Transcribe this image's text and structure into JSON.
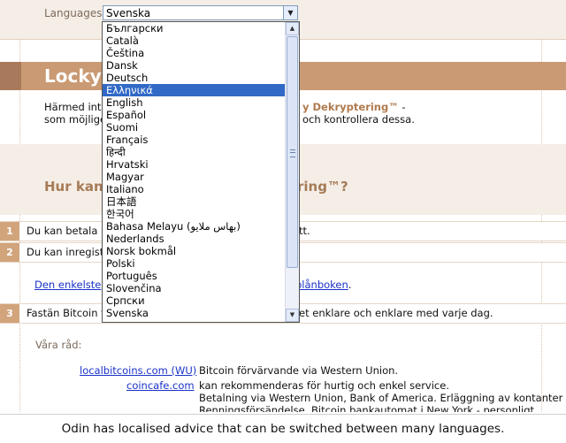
{
  "languages": {
    "label": "Languages:",
    "selected": "Svenska",
    "options": [
      "Български",
      "Català",
      "Čeština",
      "Dansk",
      "Deutsch",
      "Ελληνικά",
      "English",
      "Español",
      "Suomi",
      "Français",
      "हिन्दी",
      "Hrvatski",
      "Magyar",
      "Italiano",
      "日本語",
      "한국어",
      "Bahasa Melayu (بهاس ملايو)",
      "Nederlands",
      "Norsk bokmål",
      "Polski",
      "Português",
      "Slovenčina",
      "Српски",
      "Svenska"
    ],
    "highlighted": "Ελληνικά"
  },
  "header": {
    "title": "Locky"
  },
  "intro": {
    "line1_prefix": "Härmed intr",
    "line1_highlight": "y Dekryptering™",
    "line1_suffix": " -",
    "line2_prefix": "som möjlige",
    "line2_suffix": "och kontrollera dessa."
  },
  "question": {
    "prefix": "Hur kan",
    "suffix": "ring™?"
  },
  "steps": [
    {
      "number": "1",
      "text_prefix": "Du kan betala n",
      "text_suffix": "tt."
    },
    {
      "number": "2",
      "text": "Du kan inregistr"
    },
    {
      "number": "3",
      "text_prefix": "Fastän Bitcoin fö",
      "text_suffix": "et enklare och enklare med varje dag."
    }
  ],
  "sub_link": {
    "prefix": "Den enkelste",
    "suffix": "plånboken"
  },
  "advice": {
    "label": "Våra råd:",
    "rows": [
      {
        "link": "localbitcoins.com (WU)",
        "desc": "Bitcoin förvärvande via Western Union."
      },
      {
        "link": "coincafe.com",
        "desc": "kan rekommenderas för hurtig och enkel service."
      },
      {
        "desc": "Betalning via Western Union, Bank of America. Erläggning av kontanter via F"
      },
      {
        "desc": "Renningsförsändelse. Bitcoin bankautomat i New York - personligt"
      }
    ]
  },
  "caption": "Odin has localised advice that can be switched between many languages."
}
